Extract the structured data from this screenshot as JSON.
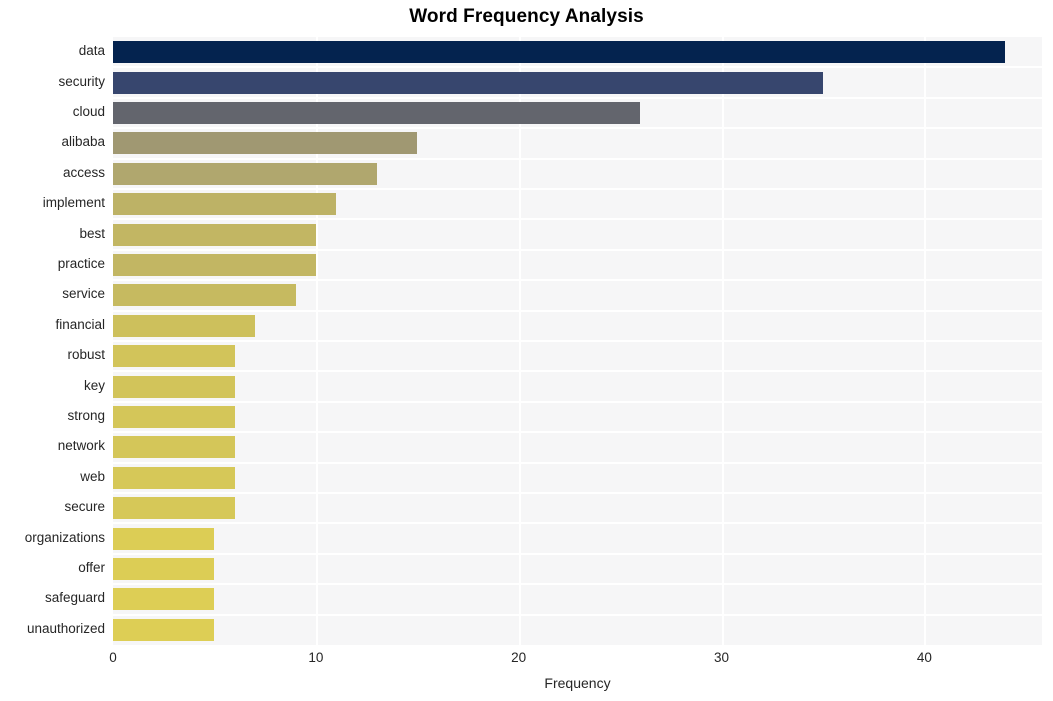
{
  "chart_data": {
    "type": "bar",
    "orientation": "horizontal",
    "title": "Word Frequency Analysis",
    "xlabel": "Frequency",
    "ylabel": "",
    "categories": [
      "data",
      "security",
      "cloud",
      "alibaba",
      "access",
      "implement",
      "best",
      "practice",
      "service",
      "financial",
      "robust",
      "key",
      "strong",
      "network",
      "web",
      "secure",
      "organizations",
      "offer",
      "safeguard",
      "unauthorized"
    ],
    "values": [
      44,
      35,
      26,
      15,
      13,
      11,
      10,
      10,
      9,
      7,
      6,
      6,
      6,
      6,
      6,
      6,
      5,
      5,
      5,
      5
    ],
    "bar_colors": [
      "#04234f",
      "#37466e",
      "#63656d",
      "#a09872",
      "#b0a76e",
      "#bdb266",
      "#c2b663",
      "#c2b663",
      "#c6ba60",
      "#cdc05c",
      "#d2c45a",
      "#d2c45a",
      "#d4c659",
      "#d4c659",
      "#d6c858",
      "#d6c858",
      "#dccd55",
      "#dccd55",
      "#ddce55",
      "#ddce55"
    ],
    "xlim": [
      0,
      45.8
    ],
    "xticks": [
      0,
      10,
      20,
      30,
      40
    ],
    "xtick_labels": [
      "0",
      "10",
      "20",
      "30",
      "40"
    ],
    "grid": true,
    "grid_color": "#ffffff",
    "plot_background": "#f6f6f7",
    "figure_background": "#ffffff",
    "legend": null
  }
}
